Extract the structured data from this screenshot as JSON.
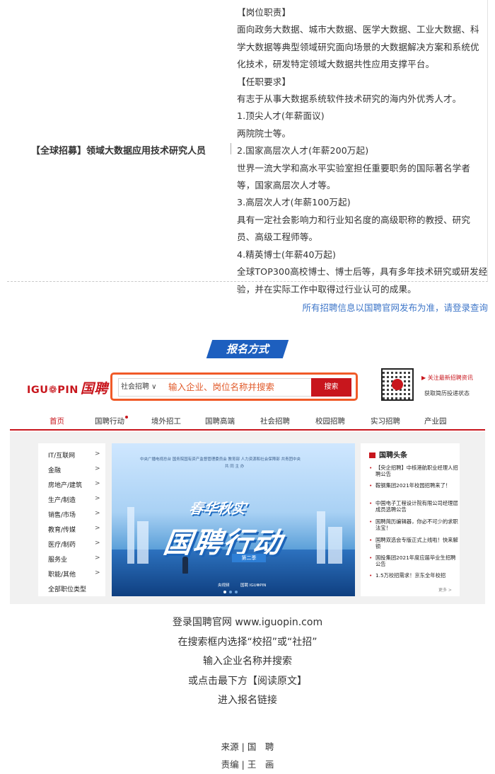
{
  "job": {
    "title": "【全球招募】领域大数据应用技术研究人员",
    "description": [
      "【岗位职责】",
      "面向政务大数据、城市大数据、医学大数据、工业大数据、科",
      "学大数据等典型领域研究面向场景的大数据解决方案和系统优",
      "化技术，研发特定领域大数据共性应用支撑平台。",
      "【任职要求】",
      "有志于从事大数据系统软件技术研究的海内外优秀人才。",
      "1.顶尖人才(年薪面议)",
      "两院院士等。",
      "2.国家高层次人才(年薪200万起)",
      "世界一流大学和高水平实验室担任重要职务的国际著名学者",
      "等，国家高层次人才等。",
      "3.高层次人才(年薪100万起)",
      "具有一定社会影响力和行业知名度的高级职称的教授、研究",
      "员、高级工程师等。",
      "4.精英博士(年薪40万起)",
      "全球TOP300高校博士、博士后等，具有多年技术研究或研发经",
      "验，并在实际工作中取得过行业认可的成果。"
    ]
  },
  "notice": "所有招聘信息以国聘官网发布为准，请登录查询",
  "section_title": "报名方式",
  "site": {
    "logo_latin": "IGU❁PIN",
    "logo_cn": "国聘",
    "search_select": "社会招聘 ∨",
    "search_placeholder": "输入企业、岗位名称并搜索",
    "search_button": "搜索",
    "header_link1": "▶ 关注最新招聘资讯",
    "header_link2": "获取简历投递状态",
    "nav": [
      "首页",
      "国聘行动",
      "境外招工",
      "国聘高端",
      "社会招聘",
      "校园招聘",
      "实习招聘",
      "产业园"
    ],
    "categories": [
      "IT/互联网",
      "金融",
      "房地产/建筑",
      "生产/制造",
      "销售/市场",
      "教育/传媒",
      "医疗/制药",
      "服务业",
      "职能/其他",
      "全部职位类型"
    ],
    "category_arrow": ">",
    "hero": {
      "top_line": "中央广播电视总台  国务院国有资产监督管理委员会  教育部  人力资源和社会保障部  共青团中央",
      "sub_line": "共 同 主 办",
      "slogan": "春华秋实",
      "main": "国聘行动",
      "season": "第二季",
      "logo1": "央视频",
      "logo2": "国聘 IGU❁PIN"
    },
    "news_title": "国聘头条",
    "news": [
      "【央企招聘】中核港航职业经理人招聘公告",
      "鞍钢集团2021年校园招聘来了！",
      "中国电子工程设计院有限公司经理层成员选聘公告",
      "国聘简历编辑器，你必不可少的求职法宝！",
      "国聘双选会专版正式上线啦！快来解锁",
      "国投集团2021年度应届毕业生招聘公告",
      "1.5万校招需求！京东全年校招"
    ],
    "news_more": "更多 >"
  },
  "steps": [
    "登录国聘官网 www.iguopin.com",
    "在搜索框内选择“校招”或“社招”",
    "输入企业名称并搜索",
    "或点击最下方【阅读原文】",
    "进入报名链接"
  ],
  "credits": [
    "来源 | 国　聘",
    "责编 | 王　画"
  ]
}
